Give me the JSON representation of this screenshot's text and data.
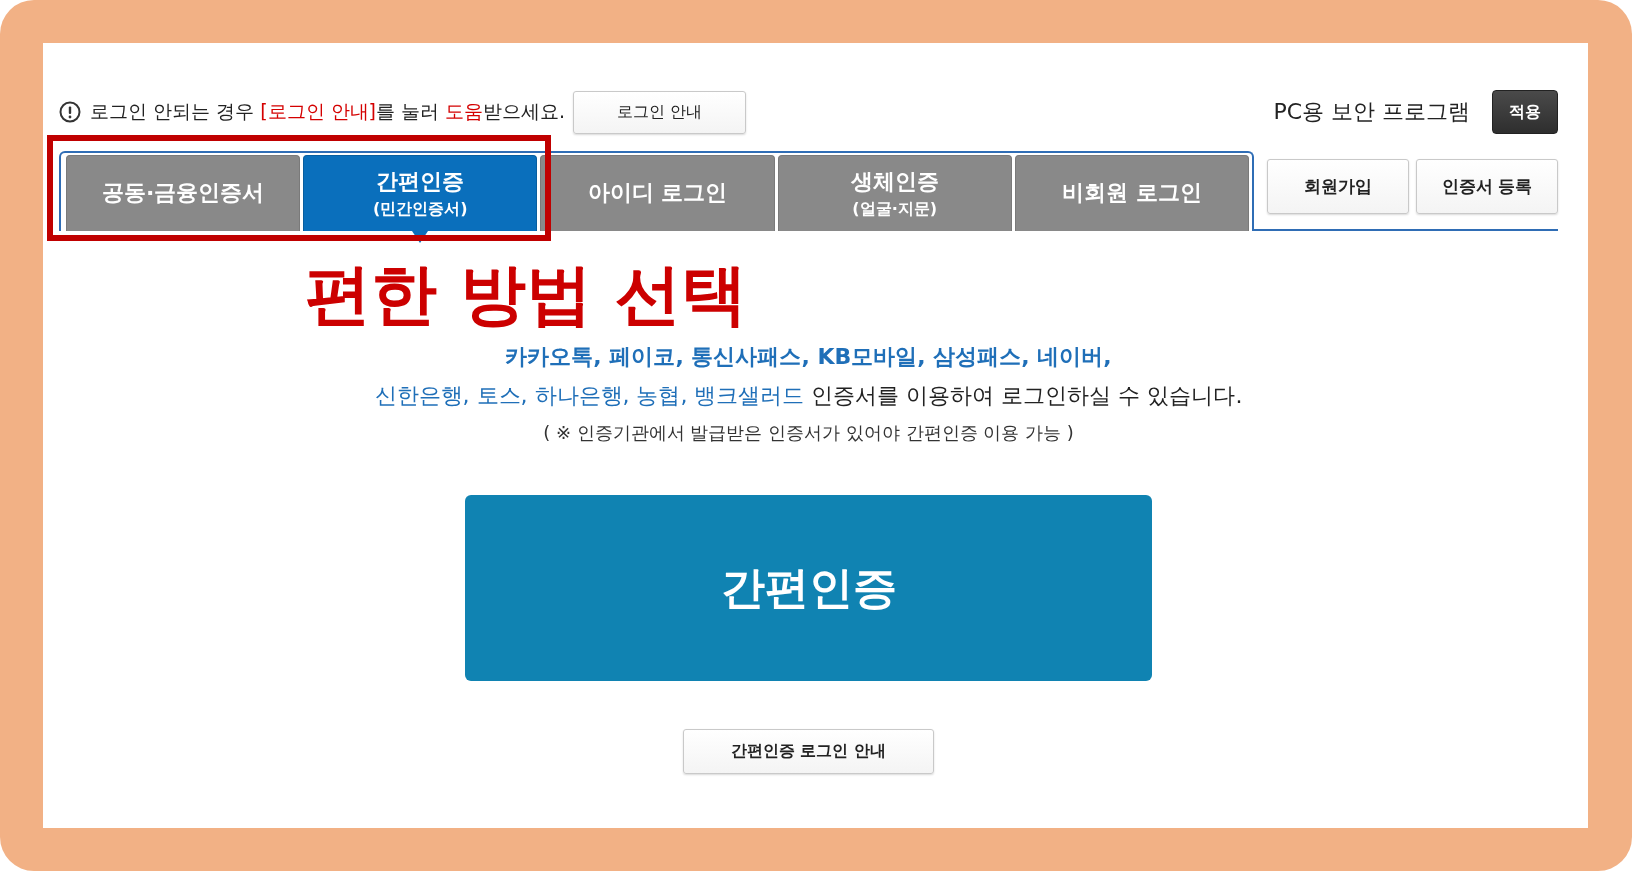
{
  "notice": {
    "segments": [
      {
        "text": "로그인 안되는 경우 ",
        "emphasis": false
      },
      {
        "text": "[로그인 안내]",
        "emphasis": true
      },
      {
        "text": "를 눌러 ",
        "emphasis": false
      },
      {
        "text": "도움",
        "emphasis": true
      },
      {
        "text": "받으세요.",
        "emphasis": false
      }
    ]
  },
  "login_guide_button": "로그인 안내",
  "security_program": {
    "label": "PC용 보안 프로그램",
    "button": "적용"
  },
  "tabs": [
    {
      "label": "공동·금융인증서",
      "selected": false
    },
    {
      "label": "간편인증",
      "sublabel": "(민간인증서)",
      "selected": true
    },
    {
      "label": "아이디 로그인",
      "selected": false
    },
    {
      "label": "생체인증",
      "sublabel": "(얼굴·지문)",
      "selected": false
    },
    {
      "label": "비회원 로그인",
      "selected": false
    }
  ],
  "side_buttons": [
    "회원가입",
    "인증서 등록"
  ],
  "annotation": "편한 방법 선택",
  "description": {
    "lines": [
      {
        "segments": [
          {
            "text": "카카오톡, 페이코, 통신사패스, KB모바일, 삼성패스, 네이버,",
            "emphasis": true
          }
        ]
      },
      {
        "segments": [
          {
            "text": "신한은행, 토스, 하나은행, 농협, 뱅크샐러드",
            "emphasis": true
          },
          {
            "text": " 인증서를 이용하여 로그인하실 수 있습니다.",
            "emphasis": false
          }
        ]
      }
    ]
  },
  "note": "( ※ 인증기관에서 발급받은 인증서가 있어야 간편인증 이용 가능 )",
  "primary_button": "간편인증",
  "guide_button": "간편인증 로그인 안내"
}
